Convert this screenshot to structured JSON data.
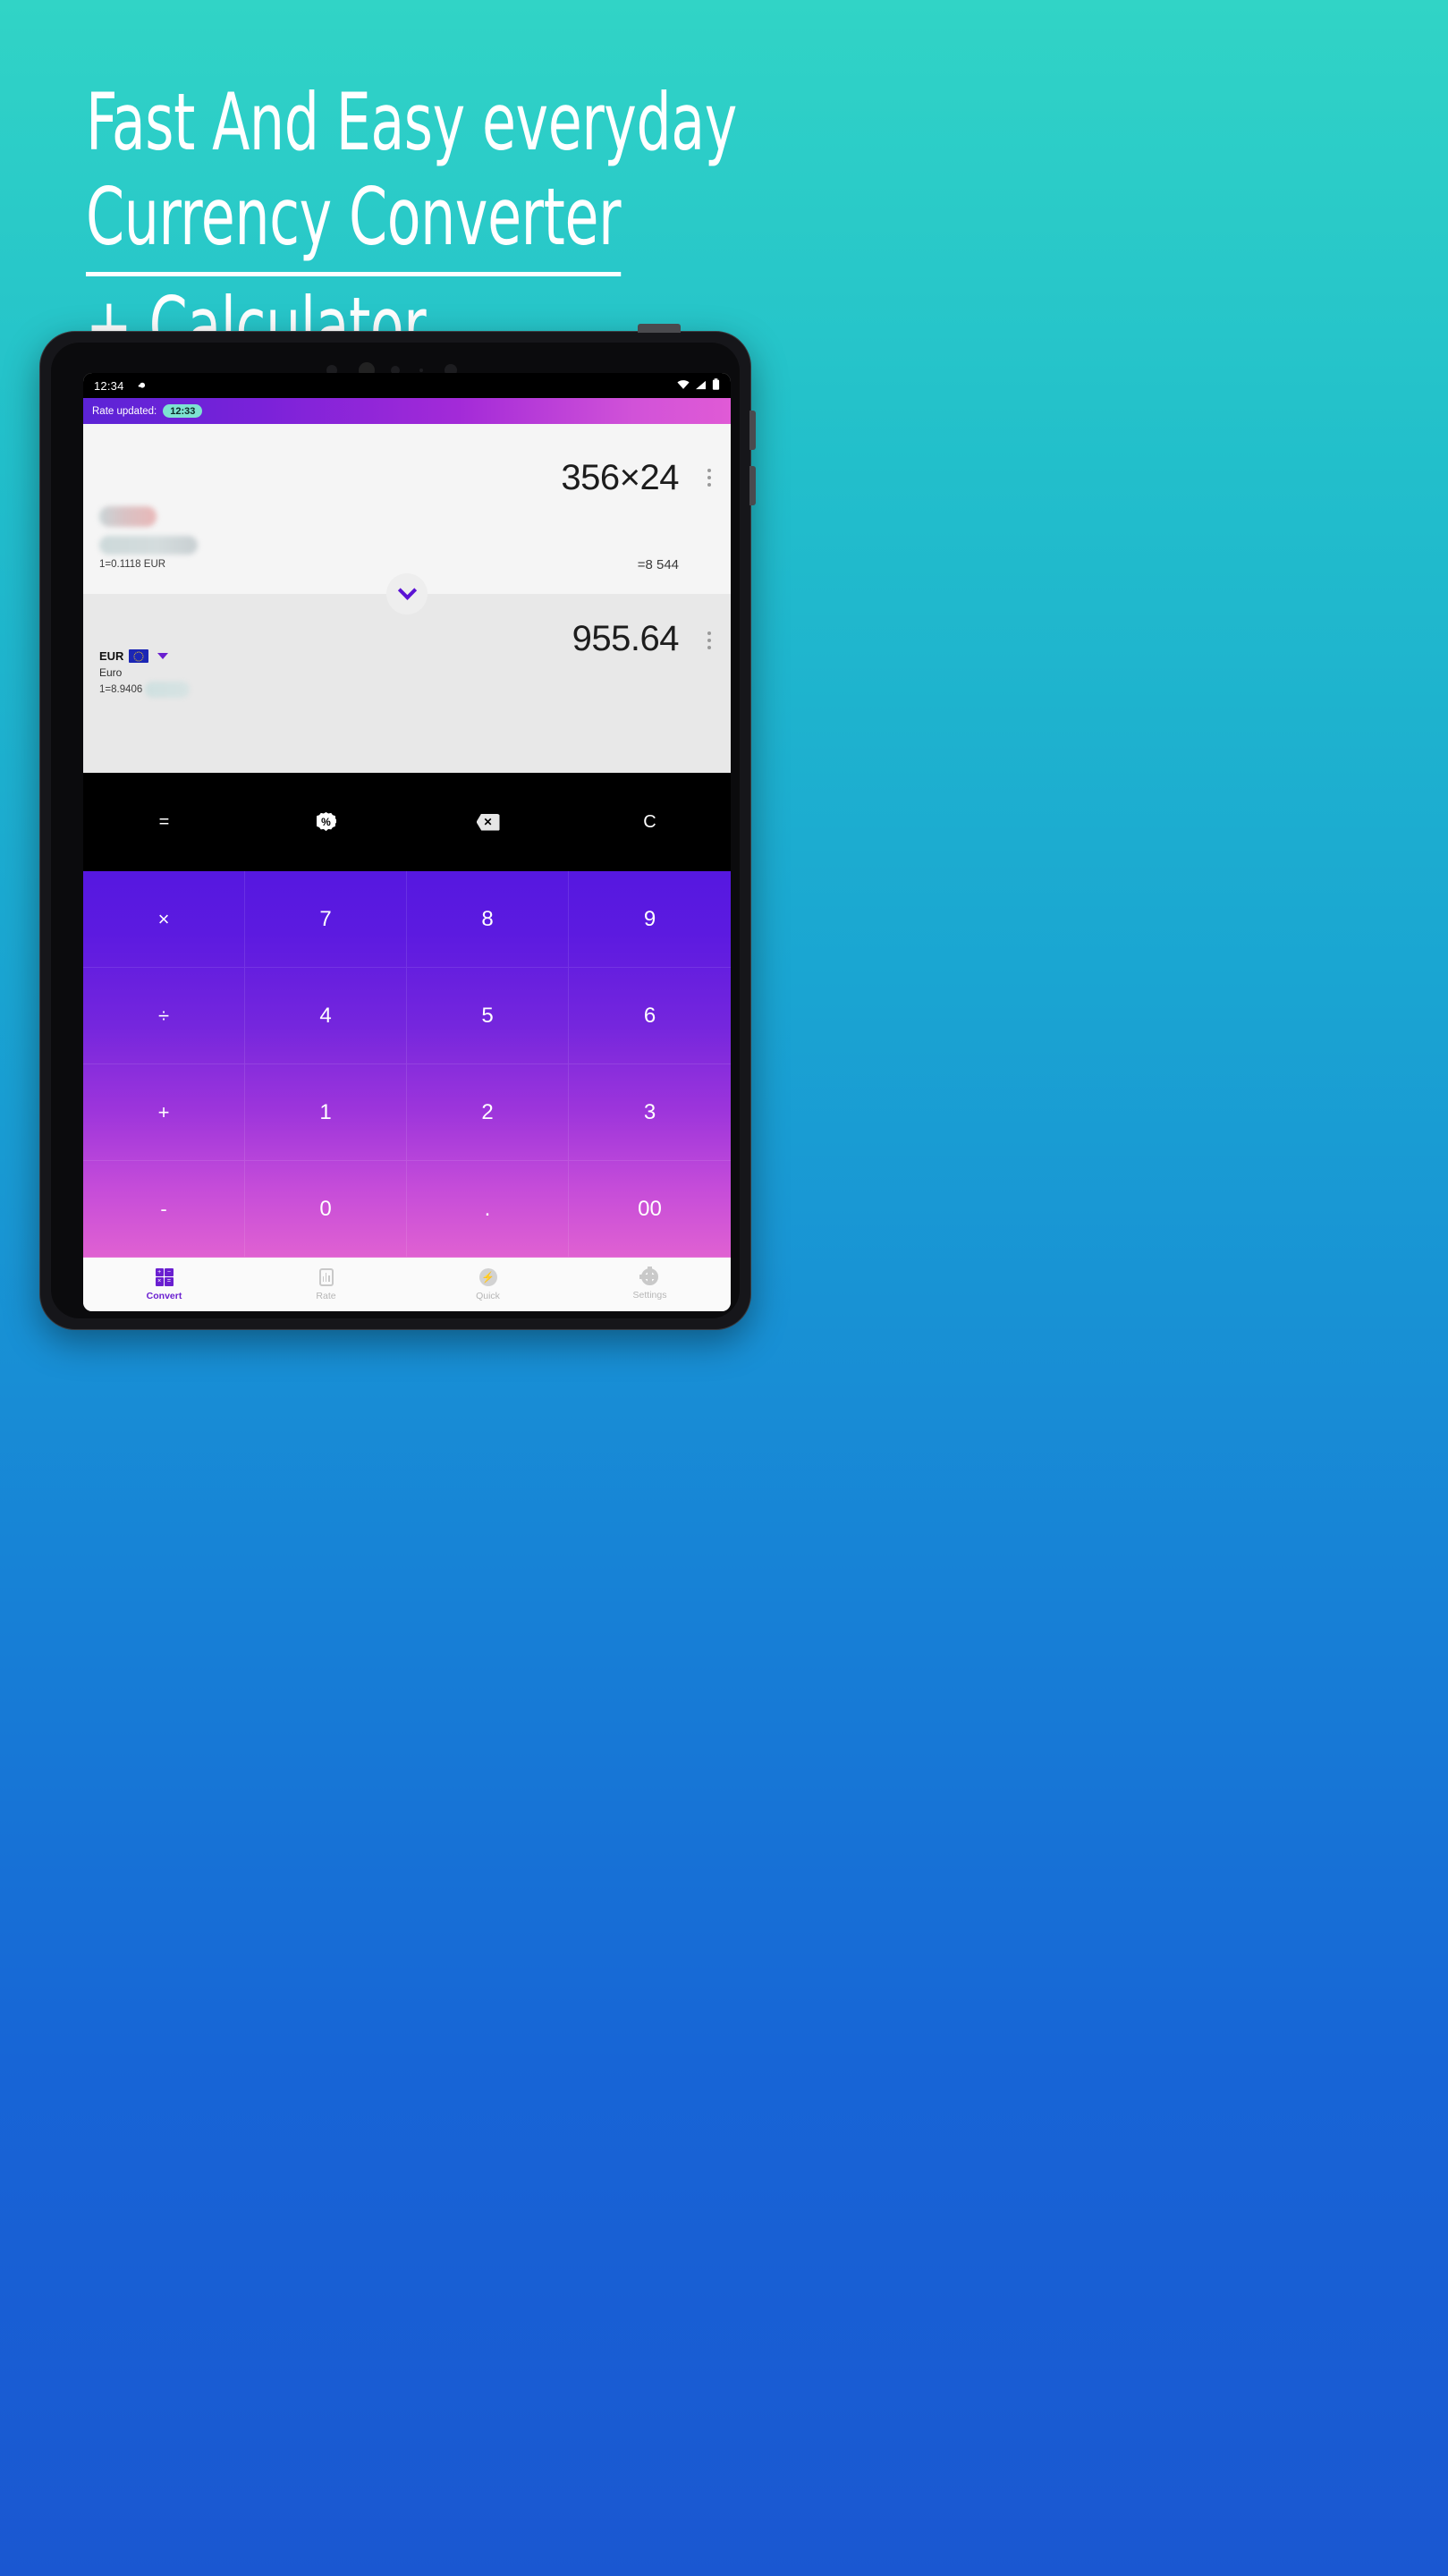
{
  "headline": {
    "line1": "Fast And Easy everyday",
    "line2": "Currency Converter",
    "line3": "+ Calculator"
  },
  "colors": {
    "bg_top": "#31d4c6",
    "bg_bottom": "#1a57d1",
    "accent_purple": "#6a1fd0",
    "badge_teal": "#7de2d1",
    "keypad_top": "#5618e0",
    "keypad_bottom": "#e061d2"
  },
  "statusbar": {
    "time": "12:34",
    "left_icon": "notification-icon",
    "right_icons": [
      "wifi-icon",
      "signal-icon",
      "battery-icon"
    ]
  },
  "appbar": {
    "label": "Rate updated:",
    "badge_time": "12:33"
  },
  "panel_top": {
    "expression": "356×24",
    "result": "=8 544",
    "rate_text": "1=0.1118 EUR",
    "currency_code_redacted": "",
    "currency_name_redacted": "",
    "menu_icon": "more-vert-icon"
  },
  "panel_bottom": {
    "amount": "955.64",
    "currency_code": "EUR",
    "currency_name": "Euro",
    "rate_prefix": "1=8.9406",
    "flag_icon": "flag-eu-icon",
    "dropdown_icon": "caret-down-icon",
    "menu_icon": "more-vert-icon"
  },
  "swap_button": {
    "icon": "chevron-down-icon"
  },
  "operator_row": [
    {
      "label": "=",
      "name": "equals-button",
      "kind": "text"
    },
    {
      "label": "%",
      "name": "percent-button",
      "kind": "percent"
    },
    {
      "label": "⌫",
      "name": "backspace-button",
      "kind": "backspace"
    },
    {
      "label": "C",
      "name": "clear-button",
      "kind": "text"
    }
  ],
  "keypad": [
    {
      "label": "×",
      "name": "key-multiply",
      "op": true
    },
    {
      "label": "7",
      "name": "key-7",
      "op": false
    },
    {
      "label": "8",
      "name": "key-8",
      "op": false
    },
    {
      "label": "9",
      "name": "key-9",
      "op": false
    },
    {
      "label": "÷",
      "name": "key-divide",
      "op": true
    },
    {
      "label": "4",
      "name": "key-4",
      "op": false
    },
    {
      "label": "5",
      "name": "key-5",
      "op": false
    },
    {
      "label": "6",
      "name": "key-6",
      "op": false
    },
    {
      "label": "+",
      "name": "key-plus",
      "op": true
    },
    {
      "label": "1",
      "name": "key-1",
      "op": false
    },
    {
      "label": "2",
      "name": "key-2",
      "op": false
    },
    {
      "label": "3",
      "name": "key-3",
      "op": false
    },
    {
      "label": "-",
      "name": "key-minus",
      "op": true
    },
    {
      "label": "0",
      "name": "key-0",
      "op": false
    },
    {
      "label": ".",
      "name": "key-decimal",
      "op": false
    },
    {
      "label": "00",
      "name": "key-double-zero",
      "op": false
    }
  ],
  "navbar": [
    {
      "label": "Convert",
      "name": "nav-convert",
      "icon": "calculator-grid-icon",
      "active": true
    },
    {
      "label": "Rate",
      "name": "nav-rate",
      "icon": "chart-bars-icon",
      "active": false
    },
    {
      "label": "Quick",
      "name": "nav-quick",
      "icon": "bolt-circle-icon",
      "active": false
    },
    {
      "label": "Settings",
      "name": "nav-settings",
      "icon": "gear-icon",
      "active": false
    }
  ],
  "convert_icon_glyphs": [
    "+",
    "−",
    "×",
    "="
  ]
}
